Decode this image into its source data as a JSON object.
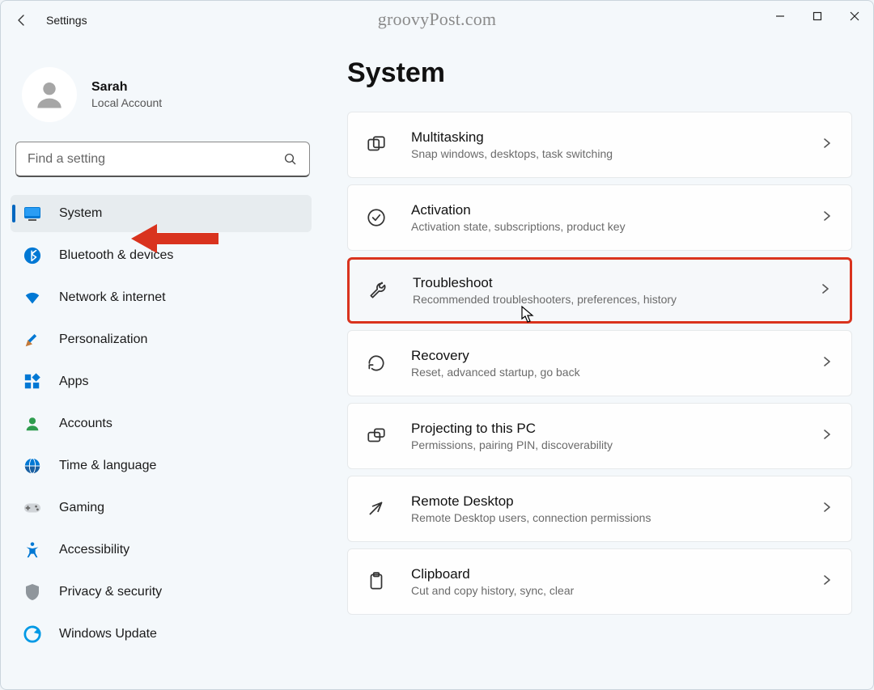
{
  "titlebar": {
    "title": "Settings"
  },
  "watermark": "groovyPost.com",
  "profile": {
    "name": "Sarah",
    "sub": "Local Account"
  },
  "search": {
    "placeholder": "Find a setting"
  },
  "nav": {
    "items": [
      {
        "id": "system",
        "label": "System",
        "active": true
      },
      {
        "id": "bluetooth",
        "label": "Bluetooth & devices"
      },
      {
        "id": "network",
        "label": "Network & internet"
      },
      {
        "id": "personalization",
        "label": "Personalization"
      },
      {
        "id": "apps",
        "label": "Apps"
      },
      {
        "id": "accounts",
        "label": "Accounts"
      },
      {
        "id": "time",
        "label": "Time & language"
      },
      {
        "id": "gaming",
        "label": "Gaming"
      },
      {
        "id": "accessibility",
        "label": "Accessibility"
      },
      {
        "id": "privacy",
        "label": "Privacy & security"
      },
      {
        "id": "update",
        "label": "Windows Update"
      }
    ]
  },
  "main": {
    "title": "System",
    "cards": [
      {
        "id": "multitasking",
        "title": "Multitasking",
        "sub": "Snap windows, desktops, task switching"
      },
      {
        "id": "activation",
        "title": "Activation",
        "sub": "Activation state, subscriptions, product key"
      },
      {
        "id": "troubleshoot",
        "title": "Troubleshoot",
        "sub": "Recommended troubleshooters, preferences, history",
        "highlighted": true
      },
      {
        "id": "recovery",
        "title": "Recovery",
        "sub": "Reset, advanced startup, go back"
      },
      {
        "id": "projecting",
        "title": "Projecting to this PC",
        "sub": "Permissions, pairing PIN, discoverability"
      },
      {
        "id": "remote",
        "title": "Remote Desktop",
        "sub": "Remote Desktop users, connection permissions"
      },
      {
        "id": "clipboard",
        "title": "Clipboard",
        "sub": "Cut and copy history, sync, clear"
      }
    ]
  }
}
